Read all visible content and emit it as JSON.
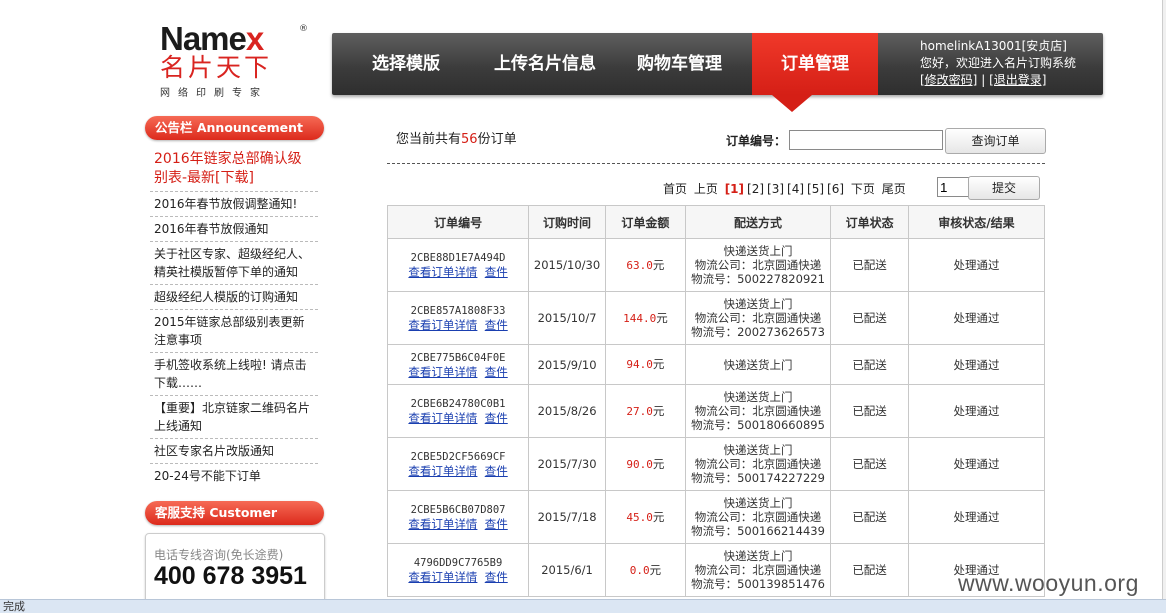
{
  "logo": {
    "brand_main": "Name",
    "brand_x": "x",
    "reg": "®",
    "cn": "名片天下",
    "sub": "网络印刷专家"
  },
  "nav": {
    "items": [
      {
        "label": "选择模版"
      },
      {
        "label": "上传名片信息"
      },
      {
        "label": "购物车管理"
      },
      {
        "label": "订单管理"
      }
    ],
    "active_index": 3
  },
  "user": {
    "line1": "homelinkA13001[安贞店]",
    "line2": "您好，欢迎进入名片订购系统",
    "change_password": "[修改密码]",
    "separator": "|",
    "logout": "[退出登录]"
  },
  "sidebar": {
    "announcement_title": "公告栏  Announcement",
    "announcements": [
      "2016年链家总部确认级别表-最新[下载]",
      "2016年春节放假调整通知!",
      "2016年春节放假通知",
      "关于社区专家、超级经纪人、精英社模版暂停下单的通知",
      "超级经纪人模版的订购通知",
      "2015年链家总部级别表更新注意事项",
      "手机签收系统上线啦! 请点击下载……",
      "【重要】北京链家二维码名片上线通知",
      "社区专家名片改版通知",
      "20-24号不能下订单"
    ],
    "customer_title": "客服支持  Customer",
    "phone_label": "电话专线咨询(免长途费)",
    "phone": "400 678 3951"
  },
  "main": {
    "total_prefix": "您当前共有",
    "total_count": "56",
    "total_suffix": "份订单",
    "order_no_label": "订单编号：",
    "query_button": "查询订单",
    "pager": {
      "first": "首页",
      "prev": "上页",
      "pages": [
        "[1]",
        "[2]",
        "[3]",
        "[4]",
        "[5]",
        "[6]"
      ],
      "current": 1,
      "next": "下页",
      "last": "尾页",
      "page_input": "1",
      "submit": "提交"
    },
    "table": {
      "headers": [
        "订单编号",
        "订购时间",
        "订单金额",
        "配送方式",
        "订单状态",
        "审核状态/结果"
      ],
      "detail_link": "查看订单详情",
      "piece_link": "查件",
      "yuan": "元",
      "rows": [
        {
          "id": "2CBE88D1E7A494D",
          "date": "2015/10/30",
          "amount": "63.0",
          "ship": "快递送货上门",
          "company": "物流公司：北京圆通快递",
          "tracking": "物流号：500227820921",
          "status": "已配送",
          "review": "处理通过"
        },
        {
          "id": "2CBE857A1808F33",
          "date": "2015/10/7",
          "amount": "144.0",
          "ship": "快递送货上门",
          "company": "物流公司：北京圆通快递",
          "tracking": "物流号：200273626573",
          "status": "已配送",
          "review": "处理通过"
        },
        {
          "id": "2CBE775B6C04F0E",
          "date": "2015/9/10",
          "amount": "94.0",
          "ship": "快递送货上门",
          "company": "",
          "tracking": "",
          "status": "已配送",
          "review": "处理通过"
        },
        {
          "id": "2CBE6B24780C0B1",
          "date": "2015/8/26",
          "amount": "27.0",
          "ship": "快递送货上门",
          "company": "物流公司：北京圆通快递",
          "tracking": "物流号：500180660895",
          "status": "已配送",
          "review": "处理通过"
        },
        {
          "id": "2CBE5D2CF5669CF",
          "date": "2015/7/30",
          "amount": "90.0",
          "ship": "快递送货上门",
          "company": "物流公司：北京圆通快递",
          "tracking": "物流号：500174227229",
          "status": "已配送",
          "review": "处理通过"
        },
        {
          "id": "2CBE5B6CB07D807",
          "date": "2015/7/18",
          "amount": "45.0",
          "ship": "快递送货上门",
          "company": "物流公司：北京圆通快递",
          "tracking": "物流号：500166214439",
          "status": "已配送",
          "review": "处理通过"
        },
        {
          "id": "4796DD9C7765B9",
          "date": "2015/6/1",
          "amount": "0.0",
          "ship": "快递送货上门",
          "company": "物流公司：北京圆通快递",
          "tracking": "物流号：500139851476",
          "status": "已配送",
          "review": "处理通过"
        }
      ]
    }
  },
  "watermark": "www.wooyun.org",
  "statusbar": "完成"
}
